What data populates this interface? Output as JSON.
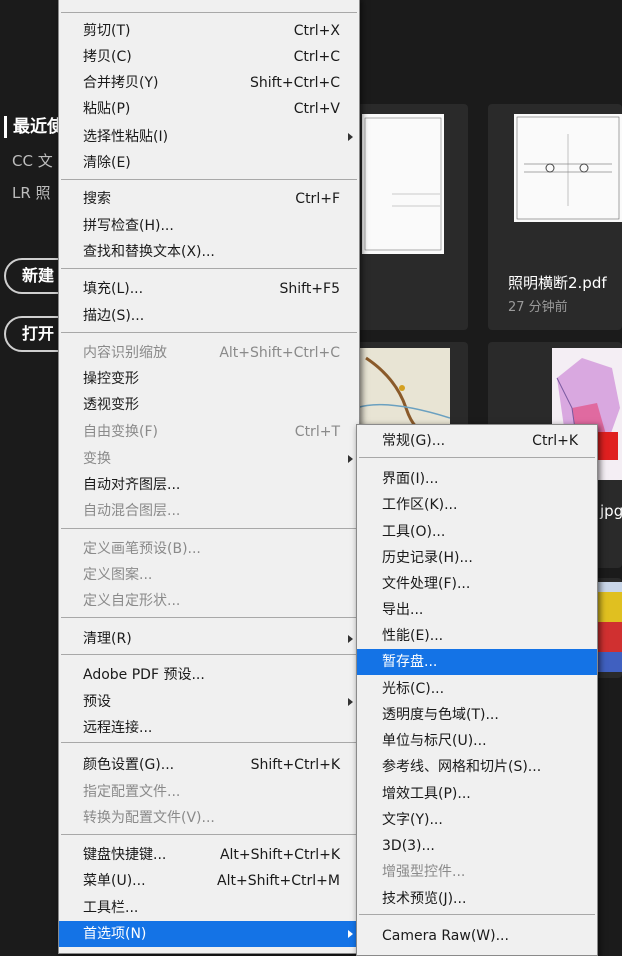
{
  "background": {
    "recent_heading": "最近使",
    "side_items": [
      "CC 文",
      "LR 照"
    ],
    "new_button": "新建",
    "open_button": "打开",
    "card1": {
      "title": "照明横断2.pdf",
      "time": "27 分钟前"
    },
    "partial_label": "jpg"
  },
  "main_menu": {
    "items": [
      {
        "label": "剪切(T)",
        "shortcut": "Ctrl+X"
      },
      {
        "label": "拷贝(C)",
        "shortcut": "Ctrl+C"
      },
      {
        "label": "合并拷贝(Y)",
        "shortcut": "Shift+Ctrl+C"
      },
      {
        "label": "粘贴(P)",
        "shortcut": "Ctrl+V"
      },
      {
        "label": "选择性粘贴(I)",
        "shortcut": ""
      },
      {
        "label": "清除(E)",
        "shortcut": ""
      },
      {
        "label": "搜索",
        "shortcut": "Ctrl+F"
      },
      {
        "label": "拼写检查(H)...",
        "shortcut": ""
      },
      {
        "label": "查找和替换文本(X)...",
        "shortcut": ""
      },
      {
        "label": "填充(L)...",
        "shortcut": "Shift+F5"
      },
      {
        "label": "描边(S)...",
        "shortcut": ""
      },
      {
        "label": "内容识别缩放",
        "shortcut": "Alt+Shift+Ctrl+C"
      },
      {
        "label": "操控变形",
        "shortcut": ""
      },
      {
        "label": "透视变形",
        "shortcut": ""
      },
      {
        "label": "自由变换(F)",
        "shortcut": "Ctrl+T"
      },
      {
        "label": "变换",
        "shortcut": ""
      },
      {
        "label": "自动对齐图层...",
        "shortcut": ""
      },
      {
        "label": "自动混合图层...",
        "shortcut": ""
      },
      {
        "label": "定义画笔预设(B)...",
        "shortcut": ""
      },
      {
        "label": "定义图案...",
        "shortcut": ""
      },
      {
        "label": "定义自定形状...",
        "shortcut": ""
      },
      {
        "label": "清理(R)",
        "shortcut": ""
      },
      {
        "label": "Adobe PDF 预设...",
        "shortcut": ""
      },
      {
        "label": "预设",
        "shortcut": ""
      },
      {
        "label": "远程连接...",
        "shortcut": ""
      },
      {
        "label": "颜色设置(G)...",
        "shortcut": "Shift+Ctrl+K"
      },
      {
        "label": "指定配置文件...",
        "shortcut": ""
      },
      {
        "label": "转换为配置文件(V)...",
        "shortcut": ""
      },
      {
        "label": "键盘快捷键...",
        "shortcut": "Alt+Shift+Ctrl+K"
      },
      {
        "label": "菜单(U)...",
        "shortcut": "Alt+Shift+Ctrl+M"
      },
      {
        "label": "工具栏...",
        "shortcut": ""
      },
      {
        "label": "首选项(N)",
        "shortcut": ""
      }
    ]
  },
  "sub_menu": {
    "items": [
      {
        "label": "常规(G)...",
        "shortcut": "Ctrl+K"
      },
      {
        "label": "界面(I)..."
      },
      {
        "label": "工作区(K)..."
      },
      {
        "label": "工具(O)..."
      },
      {
        "label": "历史记录(H)..."
      },
      {
        "label": "文件处理(F)..."
      },
      {
        "label": "导出..."
      },
      {
        "label": "性能(E)..."
      },
      {
        "label": "暂存盘..."
      },
      {
        "label": "光标(C)..."
      },
      {
        "label": "透明度与色域(T)..."
      },
      {
        "label": "单位与标尺(U)..."
      },
      {
        "label": "参考线、网格和切片(S)..."
      },
      {
        "label": "增效工具(P)..."
      },
      {
        "label": "文字(Y)..."
      },
      {
        "label": "3D(3)..."
      },
      {
        "label": "增强型控件..."
      },
      {
        "label": "技术预览(J)..."
      },
      {
        "label": "Camera Raw(W)..."
      }
    ]
  },
  "colors": {
    "highlight": "#1473e6",
    "menu_bg": "#f0f0f0",
    "app_bg": "#1b1b1b"
  }
}
